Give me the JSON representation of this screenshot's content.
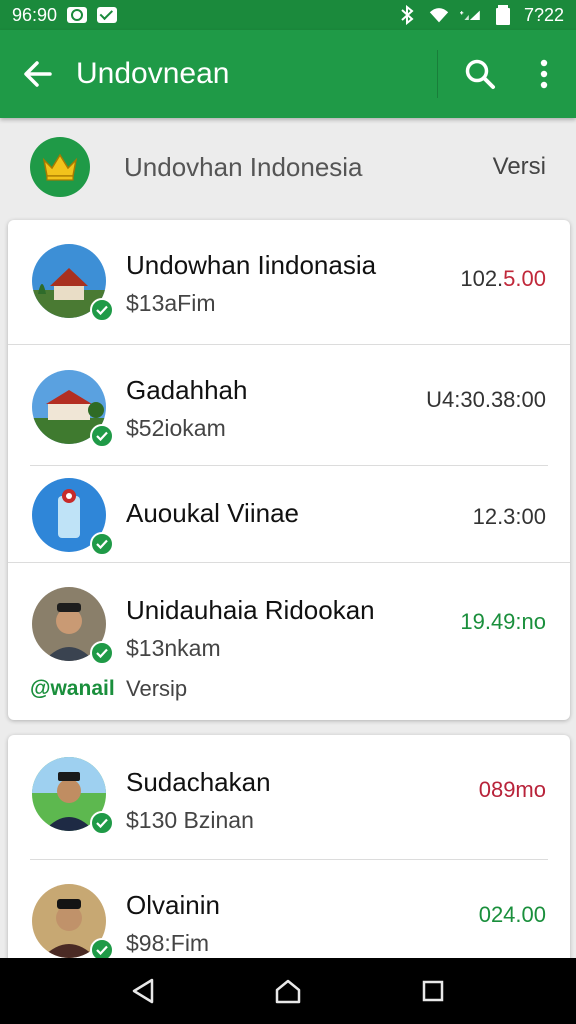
{
  "status_bar": {
    "time": "96:90",
    "right_time": "7?22"
  },
  "app_bar": {
    "title": "Undovnean"
  },
  "header": {
    "title": "Undovhan Indonesia",
    "right_label": "Versi"
  },
  "items": [
    {
      "name": "Undowhan Iindonasia",
      "sub": "$13aFim",
      "amount_prefix": "102.",
      "amount_suffix": "5.00"
    },
    {
      "name": "Gadahhah",
      "sub": "$52iokam",
      "amount": "U4:30.38:00"
    },
    {
      "name": "Auoukal Viinae",
      "amount": "12.3:00"
    },
    {
      "name": "Unidauhaia Ridookan",
      "sub": "$13nkam",
      "amount": "19.49:no",
      "handle": "@wanail",
      "footer": "Versip"
    },
    {
      "name": "Sudachakan",
      "sub": "$130 Bzinan",
      "amount": "089mo"
    },
    {
      "name": "Olvainin",
      "sub": "$98:Fim",
      "amount": "024.00"
    }
  ],
  "colors": {
    "primary": "#1f9a47",
    "status": "#1b8a3c",
    "accent_red": "#c0283a"
  }
}
